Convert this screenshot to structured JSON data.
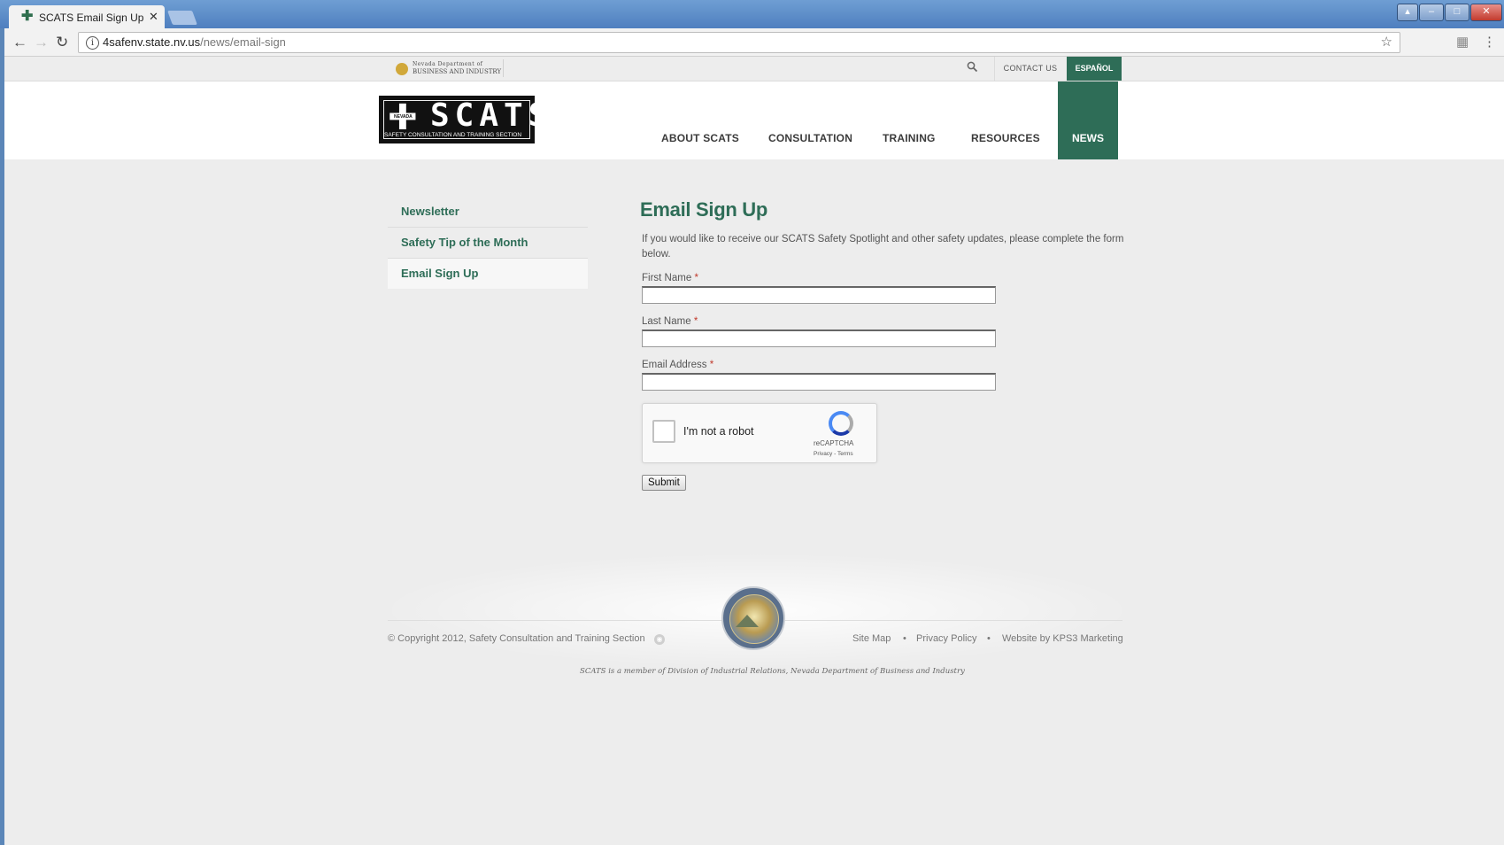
{
  "browser": {
    "tab_title": "SCATS Email Sign Up - N",
    "tab_close": "✕",
    "url_host": "4safenv.state.nv.us",
    "url_path": "/news/email-sign",
    "window_buttons": [
      "▴",
      "–",
      "□",
      "✕"
    ]
  },
  "topbar": {
    "bi_logo_line1": "Nevada Department of",
    "bi_logo_line2": "BUSINESS AND INDUSTRY",
    "contact_label": "CONTACT US",
    "espanol_label": "ESPAÑOL"
  },
  "header": {
    "logo_word": "SCATS",
    "logo_small": "NEVADA",
    "logo_tagline": "SAFETY CONSULTATION AND TRAINING SECTION",
    "nav": [
      {
        "label": "ABOUT SCATS"
      },
      {
        "label": "CONSULTATION"
      },
      {
        "label": "TRAINING"
      },
      {
        "label": "RESOURCES"
      },
      {
        "label": "NEWS"
      }
    ]
  },
  "sidebar": {
    "items": [
      {
        "label": "Newsletter"
      },
      {
        "label": "Safety Tip of the Month"
      },
      {
        "label": "Email Sign Up"
      }
    ]
  },
  "content": {
    "title": "Email Sign Up",
    "intro": "If you would like to receive our SCATS Safety Spotlight and other safety updates, please complete the form below.",
    "fields": [
      {
        "label": "First Name",
        "required_mark": "*",
        "value": ""
      },
      {
        "label": "Last Name",
        "required_mark": "*",
        "value": ""
      },
      {
        "label": "Email Address",
        "required_mark": "*",
        "value": ""
      }
    ],
    "captcha": {
      "label": "I'm not a robot",
      "brand": "reCAPTCHA",
      "terms": "Privacy - Terms"
    },
    "submit_label": "Submit"
  },
  "footer": {
    "copyright": "© Copyright 2012, Safety Consultation and Training Section",
    "links": [
      {
        "label": "Site Map"
      },
      {
        "label": "Privacy Policy"
      },
      {
        "label": "Website by KPS3 Marketing"
      }
    ],
    "separator": "•",
    "tagline": "SCATS is a member of Division of Industrial Relations, Nevada Department of Business and Industry"
  },
  "colors": {
    "accent": "#2e6d57",
    "background": "#ededed",
    "required": "#c0392b"
  }
}
